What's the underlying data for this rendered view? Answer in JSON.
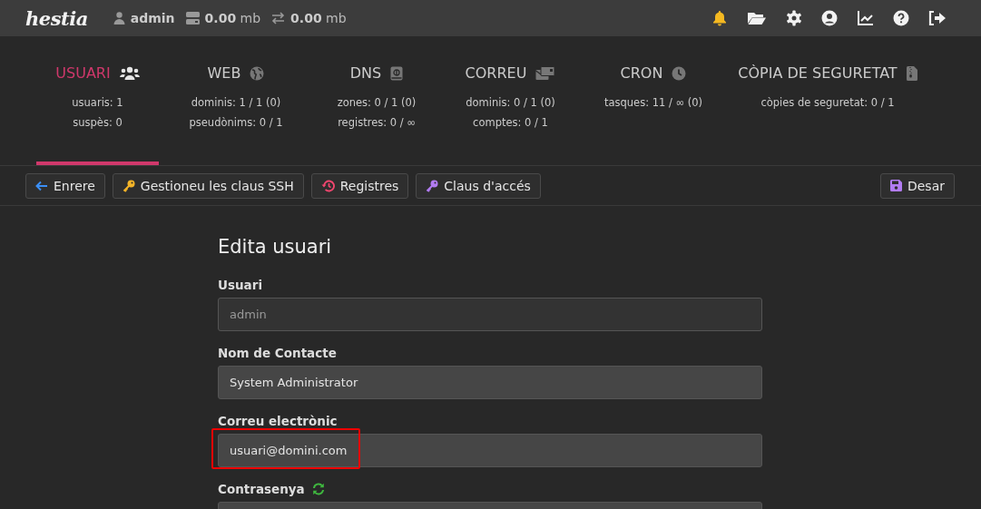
{
  "top_bar": {
    "logo": "hestia",
    "user": "admin",
    "disk": {
      "value": "0.00",
      "unit": "mb"
    },
    "bandwidth": {
      "value": "0.00",
      "unit": "mb"
    },
    "icons": [
      {
        "kind": "bell"
      },
      {
        "kind": "folder"
      },
      {
        "kind": "gear"
      },
      {
        "kind": "user"
      },
      {
        "kind": "chart"
      },
      {
        "kind": "help"
      },
      {
        "kind": "logout"
      }
    ]
  },
  "tabs": [
    {
      "label": "USUARI",
      "selected": true,
      "stats": [
        "usuaris: 1",
        "suspès: 0"
      ]
    },
    {
      "label": "WEB",
      "selected": false,
      "stats": [
        "dominis: 1 / 1 (0)",
        "pseudònims: 0 / 1"
      ]
    },
    {
      "label": "DNS",
      "selected": false,
      "stats": [
        "zones: 0 / 1 (0)",
        "registres: 0 / ∞"
      ]
    },
    {
      "label": "CORREU",
      "selected": false,
      "stats": [
        "dominis: 0 / 1 (0)",
        "comptes: 0 / 1"
      ]
    },
    {
      "label": "CRON",
      "selected": false,
      "stats": [
        "tasques: 11 / ∞ (0)"
      ]
    },
    {
      "label": "CÒPIA DE SEGURETAT",
      "selected": false,
      "stats": [
        "còpies de seguretat: 0 / 1"
      ]
    }
  ],
  "toolbar": {
    "left": [
      {
        "label": "Enrere"
      },
      {
        "label": "Gestioneu les claus SSH"
      },
      {
        "label": "Registres"
      },
      {
        "label": "Claus d'accés"
      }
    ],
    "right": [
      {
        "label": "Desar"
      }
    ]
  },
  "form": {
    "title": "Edita usuari",
    "fields": [
      {
        "label": "Usuari",
        "value": "admin",
        "disabled": true,
        "highlighted": false
      },
      {
        "label": "Nom de Contacte",
        "value": "System Administrator",
        "disabled": false,
        "highlighted": false
      },
      {
        "label": "Correu electrònic",
        "value": "usuari@domini.com",
        "disabled": false,
        "highlighted": true
      },
      {
        "label": "Contrasenya",
        "disabled": false,
        "highlighted": false
      }
    ]
  }
}
